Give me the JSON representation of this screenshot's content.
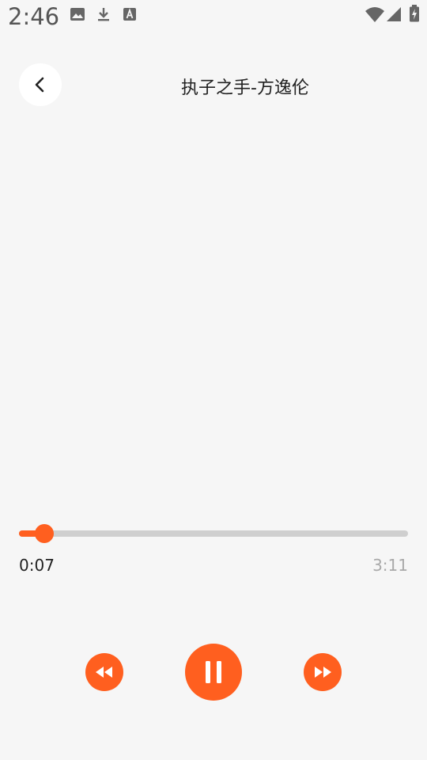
{
  "status_bar": {
    "time": "2:46",
    "icons": [
      "image-icon",
      "download-icon",
      "font-icon",
      "wifi-icon",
      "cell-signal-icon",
      "battery-icon"
    ]
  },
  "header": {
    "back_icon": "chevron-left-icon",
    "title": "执子之手-方逸伦"
  },
  "player": {
    "current_time": "0:07",
    "total_time": "3:11",
    "progress_fraction": 0.065,
    "controls": [
      "rewind-icon",
      "pause-icon",
      "fast-forward-icon"
    ]
  },
  "colors": {
    "accent": "#ff5f1f",
    "background": "#f6f6f6",
    "track": "#cfcfcf",
    "text_primary": "#222222",
    "text_secondary": "#a9a9a9"
  }
}
